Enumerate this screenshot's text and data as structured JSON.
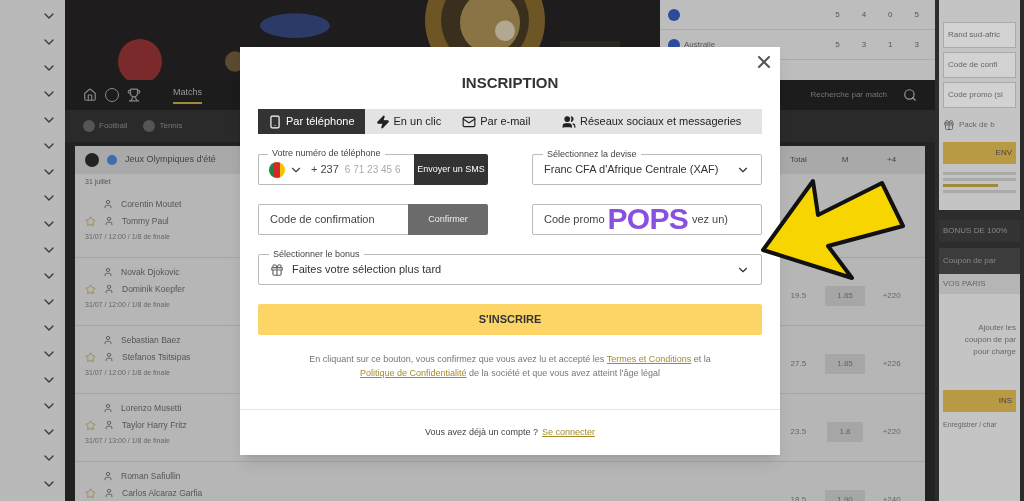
{
  "background": {
    "stats_rows": [
      {
        "country": "",
        "values": [
          "5",
          "4",
          "0",
          "5"
        ]
      },
      {
        "country": "Australie",
        "values": [
          "5",
          "3",
          "1",
          "3"
        ]
      }
    ],
    "nav": {
      "tabs": [
        {
          "label": "Matchs",
          "selected": true
        }
      ],
      "search": {
        "placeholder": "Recherche par match"
      }
    },
    "sports": [
      "Football",
      "Tennis"
    ],
    "league": "Jeux Olympiques d'été",
    "day": "31 juillet",
    "odds_header": [
      "Total",
      "M",
      "+4"
    ],
    "matches": [
      {
        "players": [
          "Corentin Moutet",
          "Tommy Paul"
        ],
        "meta": "31/07 / 12:00 / 1/8 de finale"
      },
      {
        "players": [
          "Novak Djokovic",
          "Dominik Koepfer"
        ],
        "meta": "31/07 / 12:00 / 1/8 de finale",
        "odds": [
          "19.5",
          "1.85",
          "+220"
        ]
      },
      {
        "players": [
          "Sebastian Baez",
          "Stefanos Tsitsipas"
        ],
        "meta": "31/07 / 12:00 / 1/8 de finale",
        "odds": [
          "27.5",
          "1.85",
          "+226"
        ]
      },
      {
        "players": [
          "Lorenzo Musetti",
          "Taylor Harry Fritz"
        ],
        "meta": "31/07 / 13:00 / 1/8 de finale",
        "odds": [
          "23.5",
          "1.8",
          "+220"
        ]
      },
      {
        "players": [
          "Roman Safiullin",
          "Carlos Alcaraz Garfia"
        ],
        "odds": [
          "18.5",
          "1.90",
          "+240"
        ]
      }
    ],
    "side": {
      "fields": [
        "Rand sud-afric",
        "Code de confi",
        "Code promo (si"
      ],
      "pack": "Pack de b",
      "button": "ENV",
      "bonus_bar": "BONUS DE 100%",
      "coupon_title": "Coupon de par",
      "bets_label": "VOS PARIS",
      "empty_text": [
        "Ajouter les",
        "coupon de par",
        "pour charge"
      ],
      "button2": "INS",
      "save": "Enregistrer / char"
    }
  },
  "modal": {
    "title": "INSCRIPTION",
    "tabs": [
      {
        "label": "Par téléphone",
        "selected": true
      },
      {
        "label": "En un clic",
        "selected": false
      },
      {
        "label": "Par e-mail",
        "selected": false
      },
      {
        "label": "Réseaux sociaux et messageries",
        "selected": false
      }
    ],
    "phone": {
      "label": "Votre numéro de téléphone",
      "code": "+ 237",
      "placeholder": "6 71 23 45 6",
      "button": "Envoyer un SMS"
    },
    "currency": {
      "label": "Sélectionnez la devise",
      "value": "Franc CFA d'Afrique Centrale (XAF)"
    },
    "confirmation": {
      "placeholder": "Code de confirmation",
      "button": "Confirmer"
    },
    "promo": {
      "text_start": "Code promo",
      "text_end": "vez un)"
    },
    "bonus": {
      "label": "Sélectionner le bonus",
      "value": "Faites votre sélection plus tard"
    },
    "submit": "S'INSCRIRE",
    "terms": {
      "before": "En cliquant sur ce bouton, vous confirmez que vous avez lu et accepté les",
      "link1": "Termes et Conditions",
      "middle": "et la",
      "link2": "Politique de Confidentialité",
      "after": "de la société et que vous avez atteint l'âge légal"
    },
    "footer": {
      "text": "Vous avez déjà un compte ?",
      "link": "Se connecter"
    }
  },
  "overlay_text": "POPS"
}
